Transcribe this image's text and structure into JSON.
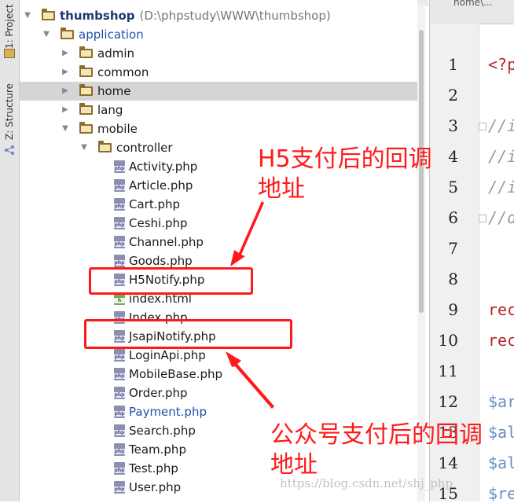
{
  "side_tabs": [
    "1: Project",
    "Z: Structure"
  ],
  "editor_tab": "home\\...",
  "tree": [
    {
      "label": "thumbshop",
      "path": "(D:\\phpstudy\\WWW\\thumbshop)",
      "type": "folder",
      "depth": 0,
      "expanded": true,
      "style": "root"
    },
    {
      "label": "application",
      "type": "folder",
      "depth": 1,
      "expanded": true,
      "style": "blue"
    },
    {
      "label": "admin",
      "type": "folder",
      "depth": 2,
      "expanded": false
    },
    {
      "label": "common",
      "type": "folder",
      "depth": 2,
      "expanded": false
    },
    {
      "label": "home",
      "type": "folder",
      "depth": 2,
      "expanded": false,
      "selected": true
    },
    {
      "label": "lang",
      "type": "folder",
      "depth": 2,
      "expanded": false
    },
    {
      "label": "mobile",
      "type": "folder",
      "depth": 2,
      "expanded": true
    },
    {
      "label": "controller",
      "type": "folder",
      "depth": 3,
      "expanded": true
    },
    {
      "label": "Activity.php",
      "type": "php",
      "depth": 4
    },
    {
      "label": "Article.php",
      "type": "php",
      "depth": 4
    },
    {
      "label": "Cart.php",
      "type": "php",
      "depth": 4
    },
    {
      "label": "Ceshi.php",
      "type": "php",
      "depth": 4
    },
    {
      "label": "Channel.php",
      "type": "php",
      "depth": 4
    },
    {
      "label": "Goods.php",
      "type": "php",
      "depth": 4
    },
    {
      "label": "H5Notify.php",
      "type": "php",
      "depth": 4
    },
    {
      "label": "index.html",
      "type": "html",
      "depth": 4
    },
    {
      "label": "Index.php",
      "type": "php",
      "depth": 4
    },
    {
      "label": "JsapiNotify.php",
      "type": "php",
      "depth": 4
    },
    {
      "label": "LoginApi.php",
      "type": "php",
      "depth": 4
    },
    {
      "label": "MobileBase.php",
      "type": "php",
      "depth": 4
    },
    {
      "label": "Order.php",
      "type": "php",
      "depth": 4
    },
    {
      "label": "Payment.php",
      "type": "php",
      "depth": 4,
      "style": "blue"
    },
    {
      "label": "Search.php",
      "type": "php",
      "depth": 4
    },
    {
      "label": "Team.php",
      "type": "php",
      "depth": 4
    },
    {
      "label": "Test.php",
      "type": "php",
      "depth": 4
    },
    {
      "label": "User.php",
      "type": "php",
      "depth": 4
    }
  ],
  "file_icon_text": {
    "php": "php",
    "html": "h"
  },
  "line_numbers": [
    "1",
    "2",
    "3",
    "4",
    "5",
    "6",
    "7",
    "8",
    "9",
    "10",
    "11",
    "12",
    "13",
    "14",
    "15"
  ],
  "code_lines": [
    {
      "text": "<?p",
      "cls": "c-kw"
    },
    {
      "text": "",
      "cls": ""
    },
    {
      "text": "//i",
      "cls": "c-cm"
    },
    {
      "text": "//i",
      "cls": "c-cm"
    },
    {
      "text": "//i",
      "cls": "c-cm"
    },
    {
      "text": "//d",
      "cls": "c-cm"
    },
    {
      "text": "",
      "cls": ""
    },
    {
      "text": "",
      "cls": ""
    },
    {
      "text": "rec",
      "cls": "c-kw"
    },
    {
      "text": "rec",
      "cls": "c-kw"
    },
    {
      "text": "",
      "cls": ""
    },
    {
      "text": "$ar",
      "cls": "c-var"
    },
    {
      "text": "$al",
      "cls": "c-var"
    },
    {
      "text": "$al",
      "cls": "c-var"
    },
    {
      "text": "$re",
      "cls": "c-var"
    }
  ],
  "annotations": {
    "h5": [
      "H5支付后的回调",
      "地址"
    ],
    "jsapi": [
      "公众号支付后的回调",
      "地址"
    ]
  },
  "watermark": "https://blog.csdn.net/shj_php",
  "colors": {
    "highlight": "#ff1a1a",
    "selected_row": "#d5d5d5"
  }
}
